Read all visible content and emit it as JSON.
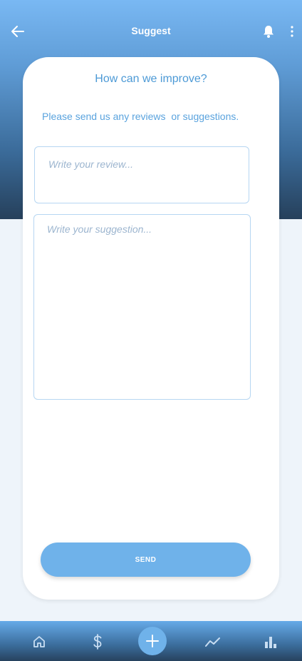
{
  "header": {
    "title": "Suggest",
    "icons": [
      "back-arrow-icon",
      "bell-icon",
      "more-vert-icon"
    ]
  },
  "card": {
    "heading": "How can we improve?",
    "subtext": "Please send us any reviews  or suggestions.",
    "review_placeholder": "Write your review...",
    "review_value": "",
    "suggestion_placeholder": "Write your suggestion...",
    "suggestion_value": "",
    "send_label": "SEND"
  },
  "bottom_nav": {
    "items": [
      "home-icon",
      "dollar-icon",
      "add-icon",
      "trend-icon",
      "bar-chart-icon"
    ]
  },
  "colors": {
    "accent": "#6fb2ea",
    "heading_text": "#4d9ad6",
    "background": "#eef4fa"
  }
}
